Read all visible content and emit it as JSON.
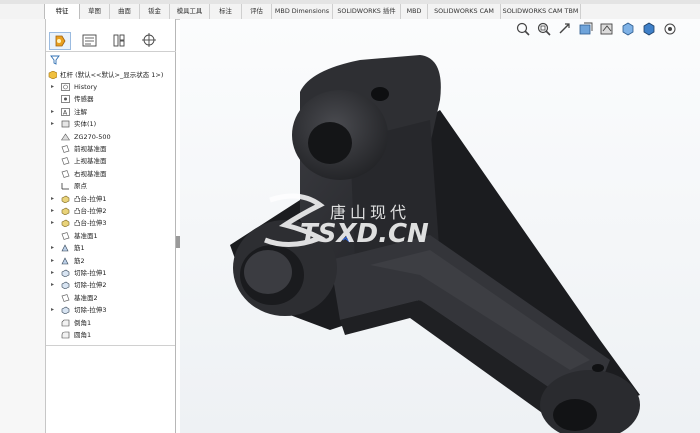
{
  "command_tabs": [
    "特征",
    "草图",
    "曲面",
    "钣金",
    "模具工具",
    "标注",
    "评估",
    "MBD Dimensions",
    "SOLIDWORKS 插件",
    "MBD",
    "SOLIDWORKS CAM",
    "SOLIDWORKS CAM TBM"
  ],
  "active_tab": "特征",
  "feature_tree": {
    "root": "杠杆 (默认<<默认>_显示状态 1>)",
    "items": [
      {
        "label": "History",
        "icon": "history-icon",
        "arrow": "▸"
      },
      {
        "label": "传感器",
        "icon": "sensor-icon",
        "arrow": ""
      },
      {
        "label": "注解",
        "icon": "annotation-icon",
        "arrow": "▸"
      },
      {
        "label": "实体(1)",
        "icon": "solid-bodies-icon",
        "arrow": "▸"
      },
      {
        "label": "ZG270-500",
        "icon": "material-icon",
        "arrow": ""
      },
      {
        "label": "前视基准面",
        "icon": "plane-icon",
        "arrow": ""
      },
      {
        "label": "上视基准面",
        "icon": "plane-icon",
        "arrow": ""
      },
      {
        "label": "右视基准面",
        "icon": "plane-icon",
        "arrow": ""
      },
      {
        "label": "原点",
        "icon": "origin-icon",
        "arrow": ""
      },
      {
        "label": "凸台-拉伸1",
        "icon": "extrude-icon",
        "arrow": "▸"
      },
      {
        "label": "凸台-拉伸2",
        "icon": "extrude-icon",
        "arrow": "▸"
      },
      {
        "label": "凸台-拉伸3",
        "icon": "extrude-icon",
        "arrow": "▸"
      },
      {
        "label": "基准面1",
        "icon": "plane-icon",
        "arrow": ""
      },
      {
        "label": "筋1",
        "icon": "rib-icon",
        "arrow": "▸"
      },
      {
        "label": "筋2",
        "icon": "rib-icon",
        "arrow": "▸"
      },
      {
        "label": "切除-拉伸1",
        "icon": "cut-icon",
        "arrow": "▸"
      },
      {
        "label": "切除-拉伸2",
        "icon": "cut-icon",
        "arrow": "▸"
      },
      {
        "label": "基准面2",
        "icon": "plane-icon",
        "arrow": ""
      },
      {
        "label": "切除-拉伸3",
        "icon": "cut-icon",
        "arrow": "▸"
      },
      {
        "label": "倒角1",
        "icon": "chamfer-icon",
        "arrow": ""
      },
      {
        "label": "圆角1",
        "icon": "fillet-icon",
        "arrow": ""
      }
    ]
  },
  "panel_tabs": [
    "feature-manager-icon",
    "property-manager-icon",
    "configuration-manager-icon",
    "dimxpert-icon"
  ],
  "view_toolbar_icons": [
    "zoom-to-fit-icon",
    "zoom-area-icon",
    "previous-view-icon",
    "section-view-icon",
    "dynamic-annotation-icon",
    "view-orientation-icon",
    "display-style-icon",
    "hide-show-icon"
  ],
  "watermark": {
    "cn": "唐山现代",
    "en": "TSXD.CN"
  },
  "colors": {
    "part": "#2b2c30",
    "accent": "#3c78c8",
    "watermark": "#ffffff"
  }
}
